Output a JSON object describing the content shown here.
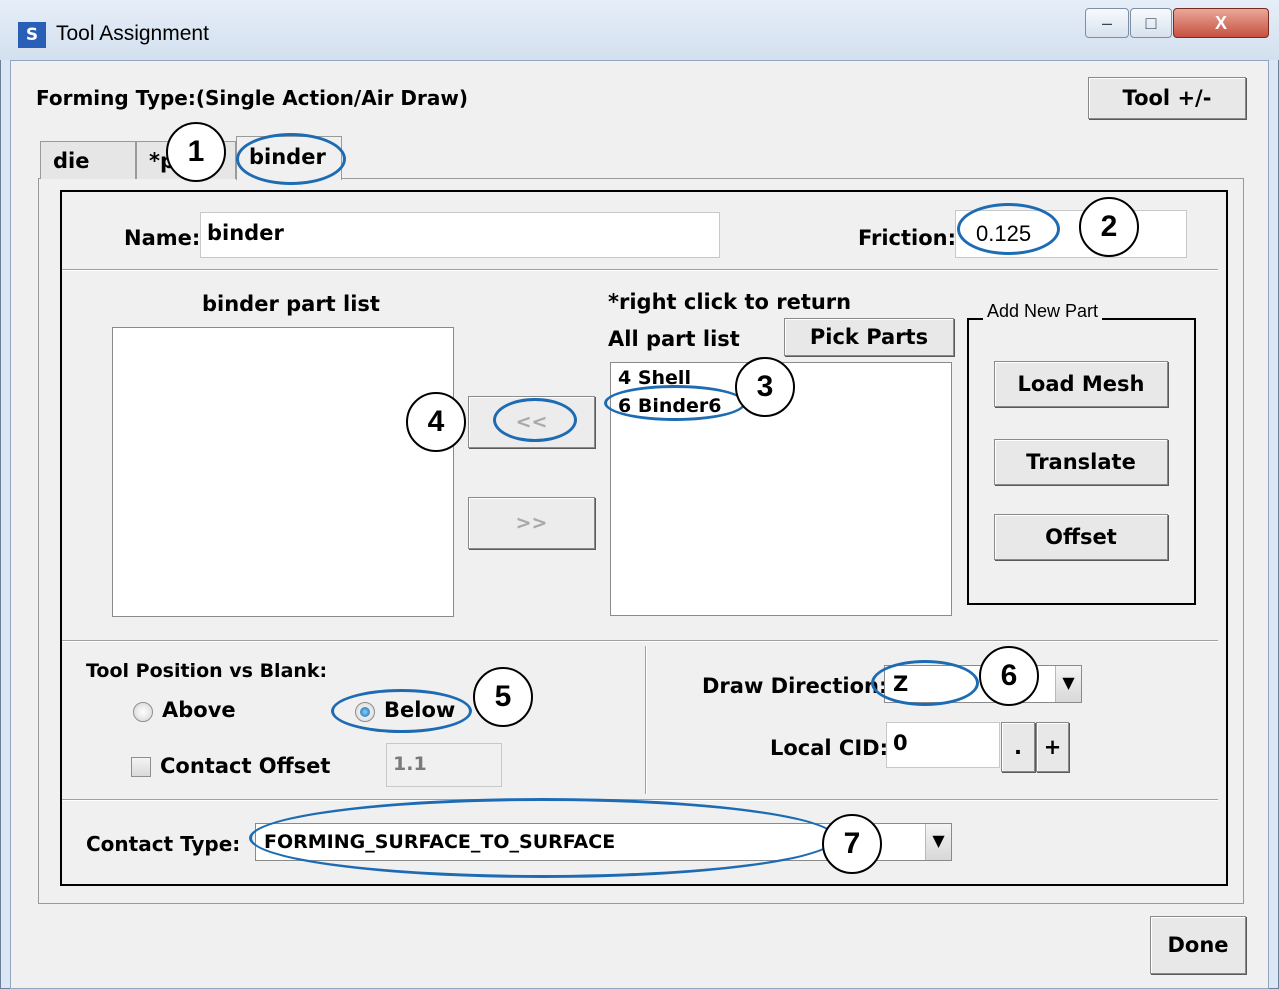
{
  "window": {
    "title": "Tool Assignment",
    "icon_name": "app-logo-icon",
    "controls": {
      "minimize": "–",
      "maximize": "□",
      "close": "X"
    }
  },
  "header": {
    "forming_type": "Forming Type:(Single Action/Air Draw)",
    "tool_button": "Tool +/-"
  },
  "tabs": [
    {
      "label": "die",
      "active": false
    },
    {
      "label": "*p",
      "active": false
    },
    {
      "label": "binder",
      "active": true
    }
  ],
  "form": {
    "name_label": "Name:",
    "name_value": "binder",
    "friction_label": "Friction:",
    "friction_value": "0.125"
  },
  "parts": {
    "part_list_title": "binder part list",
    "right_click_hint": "*right click to return",
    "all_part_list_label": "All part list",
    "pick_parts_button": "Pick Parts",
    "all_parts": [
      "4 Shell",
      "6 Binder6"
    ],
    "binder_parts": [],
    "move_left_button": "<<",
    "move_right_button": ">>"
  },
  "add_new_part": {
    "group_title": "Add New Part",
    "load_mesh_button": "Load Mesh",
    "translate_button": "Translate",
    "offset_button": "Offset"
  },
  "position": {
    "title": "Tool Position vs Blank:",
    "above_label": "Above",
    "below_label": "Below",
    "selected": "Below",
    "contact_offset_label": "Contact Offset",
    "contact_offset_checked": false,
    "contact_offset_value": "1.1"
  },
  "direction": {
    "draw_direction_label": "Draw Direction:",
    "draw_direction_value": "Z",
    "local_cid_label": "Local CID:",
    "local_cid_value": "0",
    "dot_button": ".",
    "plus_button": "+"
  },
  "contact": {
    "contact_type_label": "Contact Type:",
    "contact_type_value": "FORMING_SURFACE_TO_SURFACE"
  },
  "footer": {
    "done_button": "Done"
  },
  "annotations": [
    "1",
    "2",
    "3",
    "4",
    "5",
    "6",
    "7"
  ],
  "colors": {
    "annotation_ring": "#1d6bb3",
    "window_frame": "#dbe7f4",
    "dialog_bg": "#f0f0f0"
  }
}
